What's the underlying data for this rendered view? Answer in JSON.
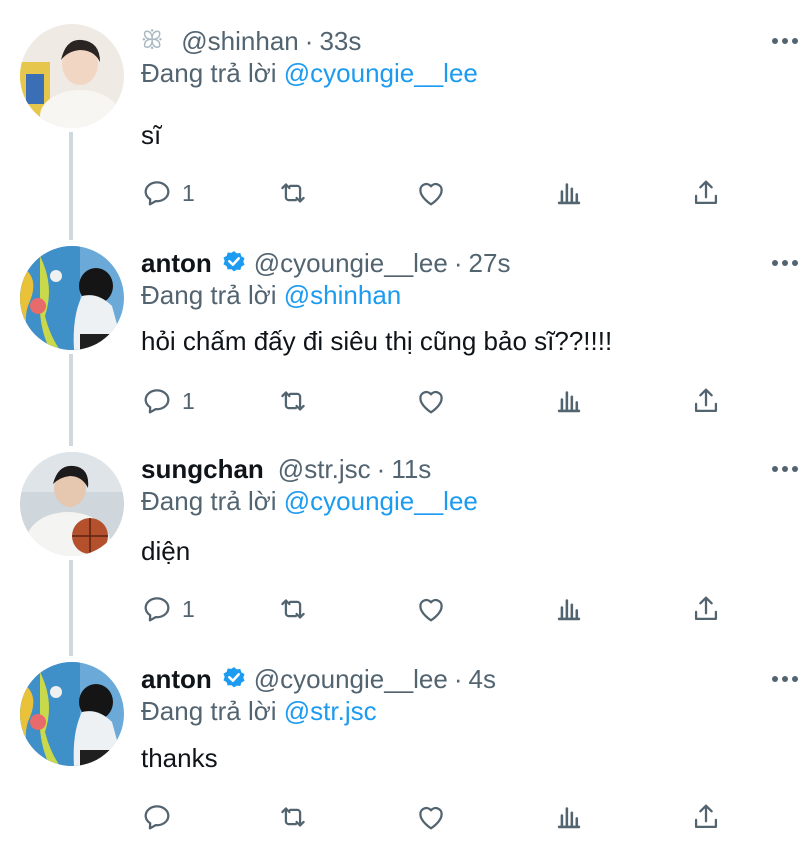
{
  "tweets": [
    {
      "display_name": "",
      "handle": "@shinhan",
      "time": "33s",
      "verified": false,
      "glyph": "ꕥ",
      "reply_prefix": "Đang trả lời ",
      "reply_to": "@cyoungie__lee",
      "text": "sĩ",
      "reply_count": "1",
      "avatar": "avatar-shinhan"
    },
    {
      "display_name": "anton",
      "handle": "@cyoungie__lee",
      "time": "27s",
      "verified": true,
      "reply_prefix": "Đang trả lời ",
      "reply_to": "@shinhan",
      "text": "hỏi chấm đấy đi siêu thị cũng bảo sĩ??!!!!",
      "reply_count": "1",
      "avatar": "avatar-anton"
    },
    {
      "display_name": "sungchan",
      "handle": "@str.jsc",
      "time": "11s",
      "verified": false,
      "reply_prefix": "Đang trả lời ",
      "reply_to": "@cyoungie__lee",
      "text": "diện",
      "reply_count": "1",
      "avatar": "avatar-sungchan"
    },
    {
      "display_name": "anton",
      "handle": "@cyoungie__lee",
      "time": "4s",
      "verified": true,
      "reply_prefix": "Đang trả lời ",
      "reply_to": "@str.jsc",
      "text": "thanks",
      "reply_count": "",
      "avatar": "avatar-anton"
    }
  ],
  "separator": "·",
  "icons": [
    "reply-icon",
    "retweet-icon",
    "like-icon",
    "analytics-icon",
    "share-icon",
    "more-icon",
    "verified-badge-icon"
  ],
  "colors": {
    "link": "#1d9bf0",
    "secondary": "#536471",
    "text": "#0f1419",
    "thread_line": "#cfd9de"
  }
}
